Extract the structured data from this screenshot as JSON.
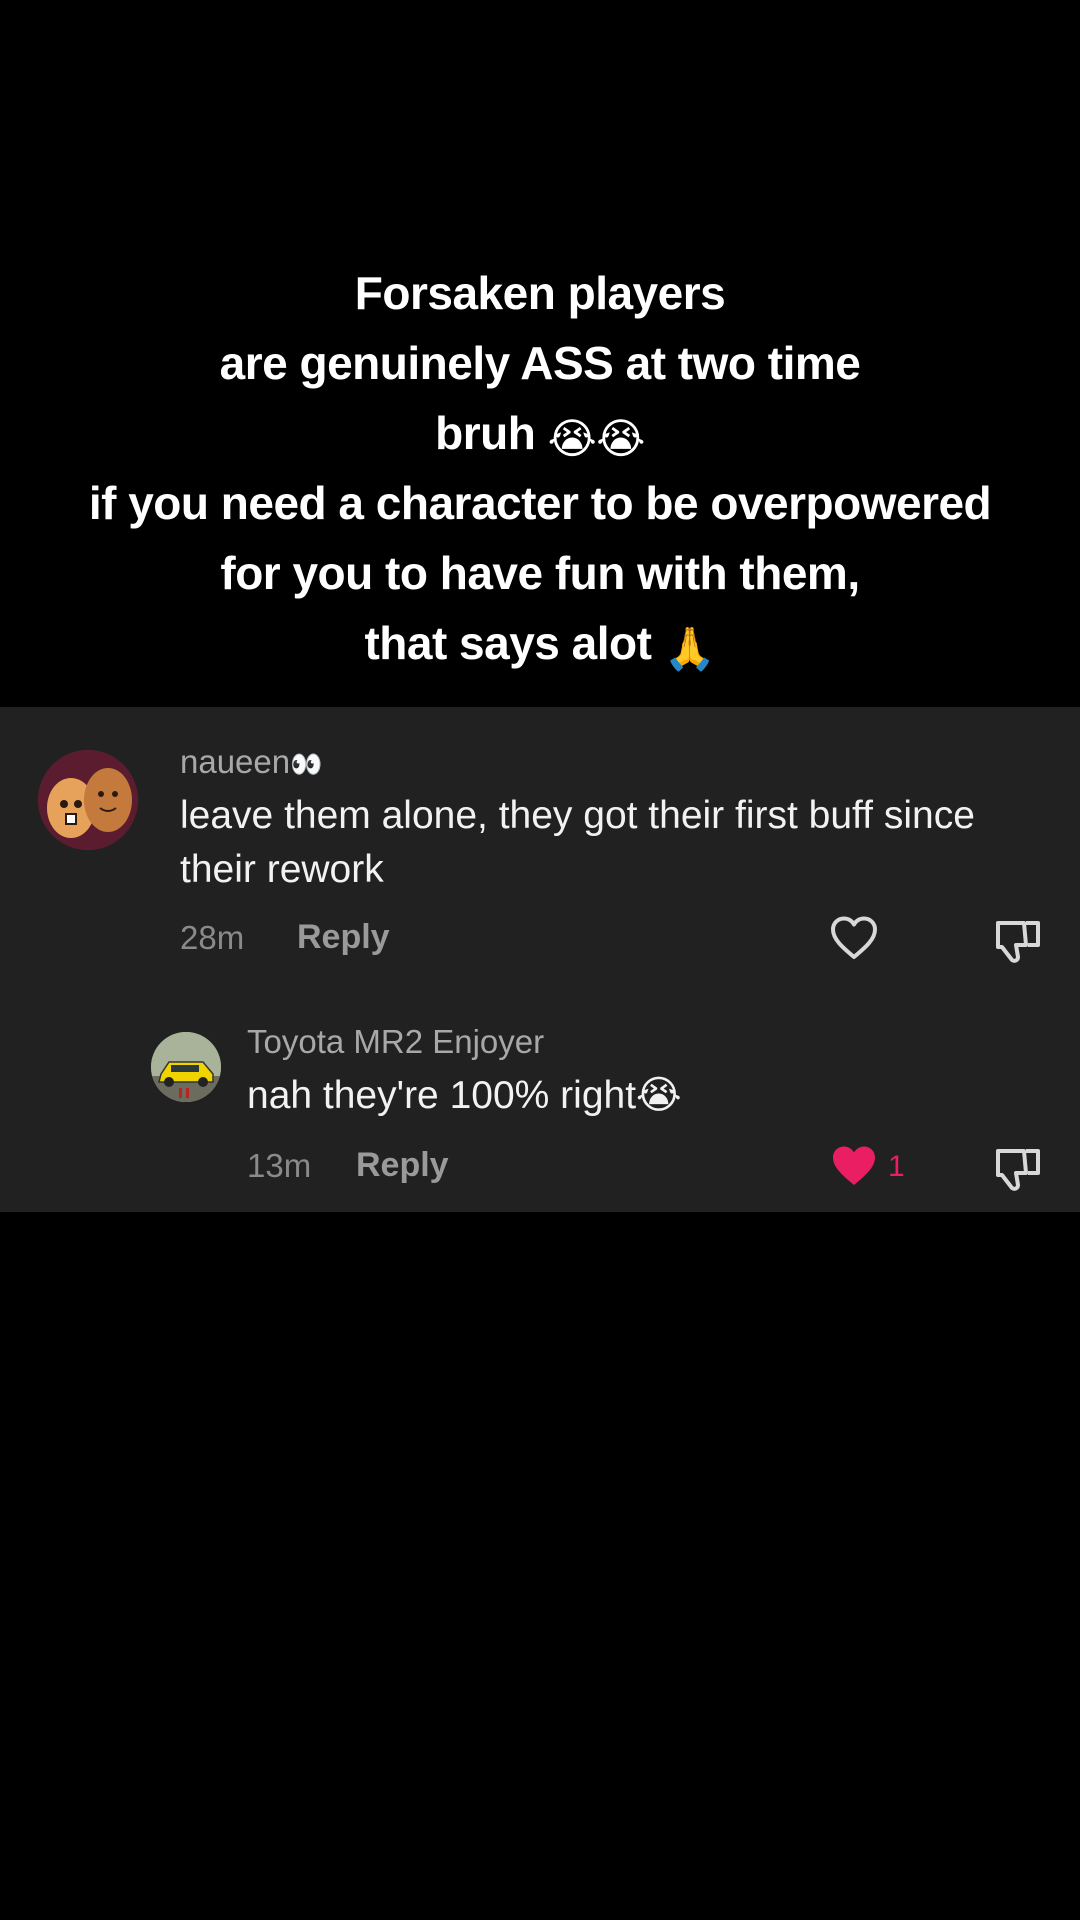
{
  "caption": {
    "lines": [
      "Forsaken players",
      "are genuinely ASS at two time",
      "bruh",
      "if you need a character to be overpowered",
      "for you to have fun with them,",
      "that says alot"
    ],
    "emoji_line3": "😭😭",
    "emoji_line6": "🙏"
  },
  "comments": [
    {
      "username": "naueen",
      "username_emoji": "👀",
      "text": "leave them alone, they got their first buff since their rework",
      "time": "28m",
      "reply_label": "Reply",
      "liked": false,
      "like_count": ""
    },
    {
      "username": "Toyota MR2 Enjoyer",
      "text": "nah they're 100% right",
      "text_emoji": "😭",
      "time": "13m",
      "reply_label": "Reply",
      "liked": true,
      "like_count": "1"
    }
  ],
  "colors": {
    "background": "#000000",
    "panel": "#212121",
    "like_active": "#e91e63",
    "muted_text": "#8a8a8a"
  },
  "icons": {
    "like": "heart-icon",
    "dislike": "thumbs-down-icon"
  }
}
